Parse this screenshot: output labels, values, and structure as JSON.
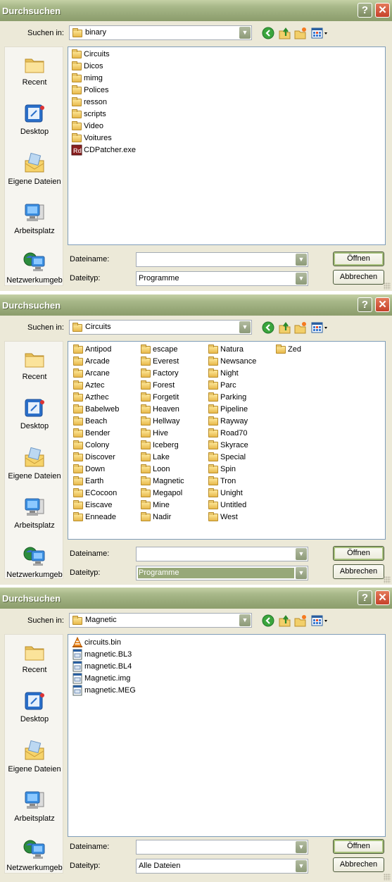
{
  "dialogs": [
    {
      "title": "Durchsuchen",
      "look_in_label": "Suchen in:",
      "look_in_value": "binary",
      "places": [
        "Recent",
        "Desktop",
        "Eigene Dateien",
        "Arbeitsplatz",
        "Netzwerkumgeb"
      ],
      "files": [
        {
          "name": "Circuits",
          "type": "folder"
        },
        {
          "name": "Dicos",
          "type": "folder"
        },
        {
          "name": "mimg",
          "type": "folder"
        },
        {
          "name": "Polices",
          "type": "folder"
        },
        {
          "name": "resson",
          "type": "folder"
        },
        {
          "name": "scripts",
          "type": "folder"
        },
        {
          "name": "Video",
          "type": "folder"
        },
        {
          "name": "Voitures",
          "type": "folder"
        },
        {
          "name": "CDPatcher.exe",
          "type": "exe"
        }
      ],
      "filename_label": "Dateiname:",
      "filename_value": "",
      "filetype_label": "Dateityp:",
      "filetype_value": "Programme",
      "filetype_selected": false,
      "open_label": "Öffnen",
      "cancel_label": "Abbrechen"
    },
    {
      "title": "Durchsuchen",
      "look_in_label": "Suchen in:",
      "look_in_value": "Circuits",
      "places": [
        "Recent",
        "Desktop",
        "Eigene Dateien",
        "Arbeitsplatz",
        "Netzwerkumgeb"
      ],
      "files": [
        {
          "name": "Antipod",
          "type": "folder"
        },
        {
          "name": "Arcade",
          "type": "folder"
        },
        {
          "name": "Arcane",
          "type": "folder"
        },
        {
          "name": "Aztec",
          "type": "folder"
        },
        {
          "name": "Azthec",
          "type": "folder"
        },
        {
          "name": "Babelweb",
          "type": "folder"
        },
        {
          "name": "Beach",
          "type": "folder"
        },
        {
          "name": "Bender",
          "type": "folder"
        },
        {
          "name": "Colony",
          "type": "folder"
        },
        {
          "name": "Discover",
          "type": "folder"
        },
        {
          "name": "Down",
          "type": "folder"
        },
        {
          "name": "Earth",
          "type": "folder"
        },
        {
          "name": "ECocoon",
          "type": "folder"
        },
        {
          "name": "Eiscave",
          "type": "folder"
        },
        {
          "name": "Enneade",
          "type": "folder"
        },
        {
          "name": "escape",
          "type": "folder"
        },
        {
          "name": "Everest",
          "type": "folder"
        },
        {
          "name": "Factory",
          "type": "folder"
        },
        {
          "name": "Forest",
          "type": "folder"
        },
        {
          "name": "Forgetit",
          "type": "folder"
        },
        {
          "name": "Heaven",
          "type": "folder"
        },
        {
          "name": "Hellway",
          "type": "folder"
        },
        {
          "name": "Hive",
          "type": "folder"
        },
        {
          "name": "Iceberg",
          "type": "folder"
        },
        {
          "name": "Lake",
          "type": "folder"
        },
        {
          "name": "Loon",
          "type": "folder"
        },
        {
          "name": "Magnetic",
          "type": "folder"
        },
        {
          "name": "Megapol",
          "type": "folder"
        },
        {
          "name": "Mine",
          "type": "folder"
        },
        {
          "name": "Nadir",
          "type": "folder"
        },
        {
          "name": "Natura",
          "type": "folder"
        },
        {
          "name": "Newsance",
          "type": "folder"
        },
        {
          "name": "Night",
          "type": "folder"
        },
        {
          "name": "Parc",
          "type": "folder"
        },
        {
          "name": "Parking",
          "type": "folder"
        },
        {
          "name": "Pipeline",
          "type": "folder"
        },
        {
          "name": "Rayway",
          "type": "folder"
        },
        {
          "name": "Road70",
          "type": "folder"
        },
        {
          "name": "Skyrace",
          "type": "folder"
        },
        {
          "name": "Special",
          "type": "folder"
        },
        {
          "name": "Spin",
          "type": "folder"
        },
        {
          "name": "Tron",
          "type": "folder"
        },
        {
          "name": "Unight",
          "type": "folder"
        },
        {
          "name": "Untitled",
          "type": "folder"
        },
        {
          "name": "West",
          "type": "folder"
        },
        {
          "name": "Zed",
          "type": "folder"
        }
      ],
      "filename_label": "Dateiname:",
      "filename_value": "",
      "filetype_label": "Dateityp:",
      "filetype_value": "Programme",
      "filetype_selected": true,
      "open_label": "Öffnen",
      "cancel_label": "Abbrechen"
    },
    {
      "title": "Durchsuchen",
      "look_in_label": "Suchen in:",
      "look_in_value": "Magnetic",
      "places": [
        "Recent",
        "Desktop",
        "Eigene Dateien",
        "Arbeitsplatz",
        "Netzwerkumgeb"
      ],
      "files": [
        {
          "name": "circuits.bin",
          "type": "vlc"
        },
        {
          "name": "magnetic.BL3",
          "type": "generic"
        },
        {
          "name": "magnetic.BL4",
          "type": "generic"
        },
        {
          "name": "Magnetic.img",
          "type": "generic"
        },
        {
          "name": "magnetic.MEG",
          "type": "generic"
        }
      ],
      "filename_label": "Dateiname:",
      "filename_value": "",
      "filetype_label": "Dateityp:",
      "filetype_value": "Alle Dateien",
      "filetype_selected": false,
      "open_label": "Öffnen",
      "cancel_label": "Abbrechen"
    }
  ],
  "icons": {
    "toolbar": [
      "back-icon",
      "up-folder-icon",
      "new-folder-icon",
      "view-menu-icon"
    ],
    "places": [
      "recent-icon",
      "desktop-icon",
      "my-documents-icon",
      "my-computer-icon",
      "network-icon"
    ]
  }
}
